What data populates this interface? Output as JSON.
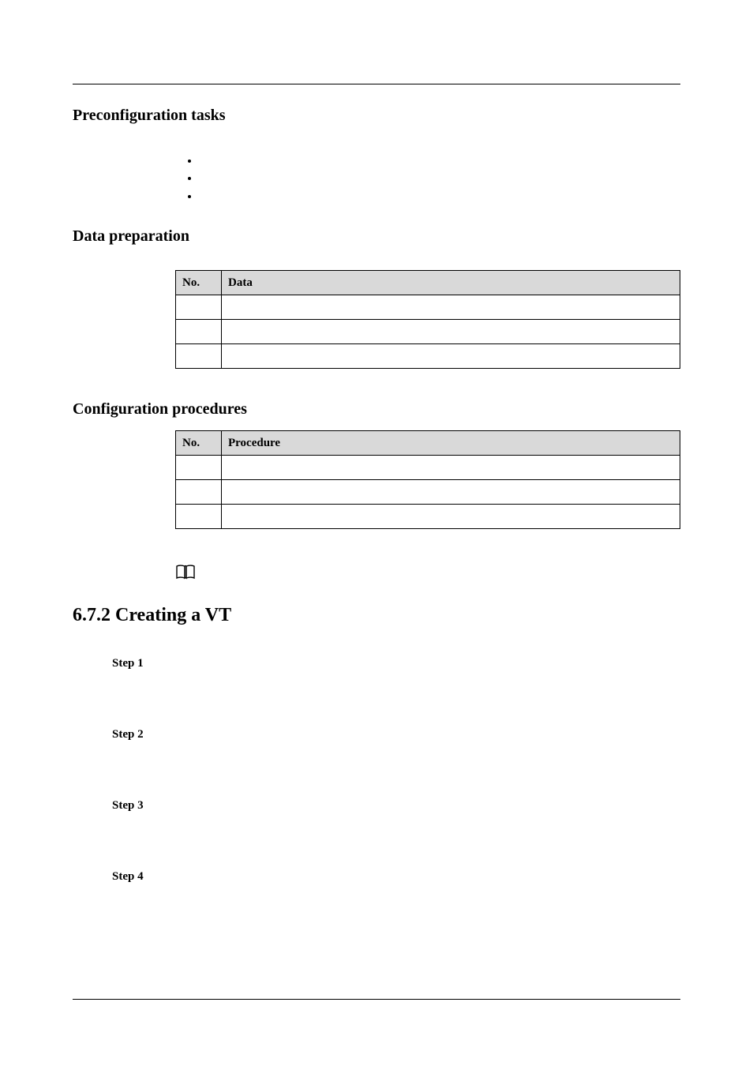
{
  "sections": {
    "preconfig_heading": "Preconfiguration tasks",
    "data_prep_heading": "Data preparation",
    "config_proc_heading": "Configuration procedures",
    "main_heading": "6.7.2 Creating a VT"
  },
  "bullets": [
    "",
    "",
    ""
  ],
  "table_data": {
    "col_no": "No.",
    "col_data": "Data",
    "rows": [
      {
        "no": "",
        "data": ""
      },
      {
        "no": "",
        "data": ""
      },
      {
        "no": "",
        "data": ""
      }
    ]
  },
  "table_proc": {
    "col_no": "No.",
    "col_proc": "Procedure",
    "rows": [
      {
        "no": "",
        "proc": ""
      },
      {
        "no": "",
        "proc": ""
      },
      {
        "no": "",
        "proc": ""
      }
    ]
  },
  "note_icon_name": "book-icon",
  "steps": {
    "s1": "Step 1",
    "s2": "Step 2",
    "s3": "Step 3",
    "s4": "Step 4"
  }
}
